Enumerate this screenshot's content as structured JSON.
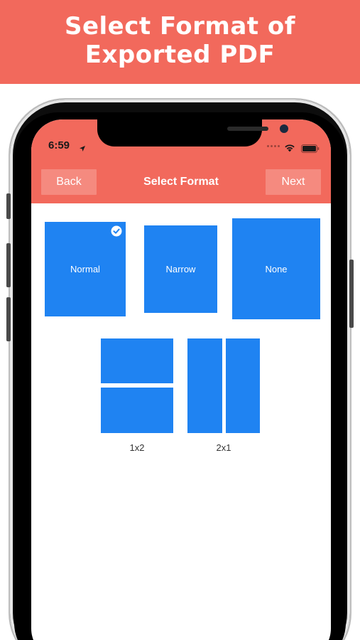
{
  "banner": {
    "line1": "Select Format of",
    "line2": "Exported PDF"
  },
  "status_bar": {
    "time": "6:59",
    "icons": [
      "location-arrow-icon",
      "cellular-dots-icon",
      "wifi-icon",
      "battery-icon"
    ]
  },
  "nav": {
    "back_label": "Back",
    "title": "Select Format",
    "next_label": "Next"
  },
  "formats": {
    "normal": {
      "label": "Normal",
      "selected": true
    },
    "narrow": {
      "label": "Narrow",
      "selected": false
    },
    "none": {
      "label": "None",
      "selected": false
    },
    "layout_1x2": {
      "label": "1x2",
      "selected": false
    },
    "layout_2x1": {
      "label": "2x1",
      "selected": false
    }
  },
  "colors": {
    "accent": "#f2695c",
    "tile": "#1f83f2",
    "text_on_accent": "#ffffff"
  }
}
